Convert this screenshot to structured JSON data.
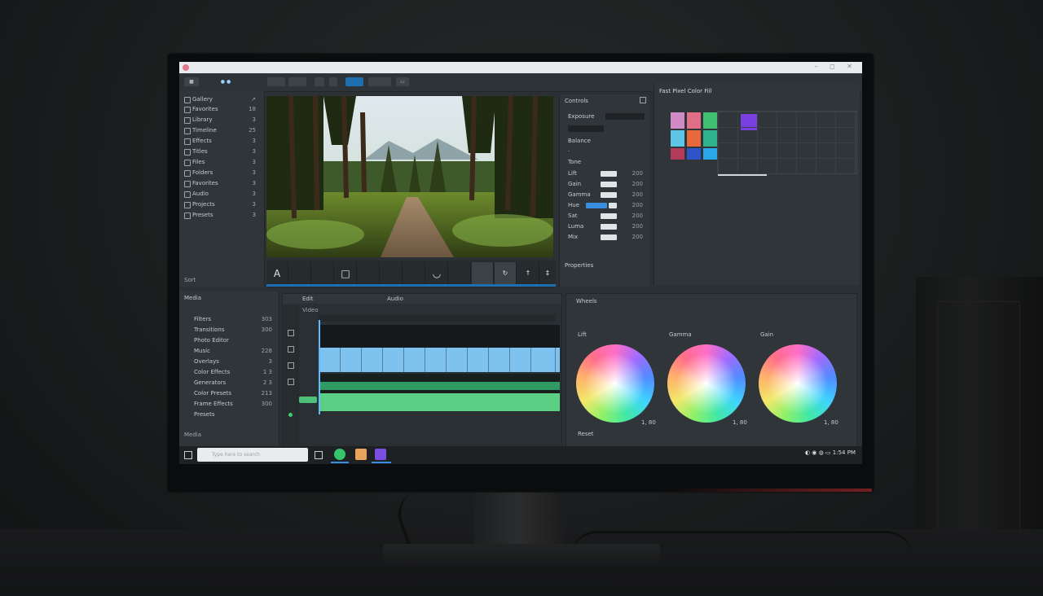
{
  "titlebar": {
    "title": "",
    "controls": "– ◻ ✕"
  },
  "toolbar": {
    "buttons": [
      "",
      "",
      "",
      "",
      "",
      ""
    ]
  },
  "sidebar": {
    "items": [
      {
        "label": "Gallery",
        "count": ""
      },
      {
        "label": "Favorites",
        "count": "18"
      },
      {
        "label": "Library",
        "count": "3"
      },
      {
        "label": "Timeline",
        "count": "25"
      },
      {
        "label": "Effects",
        "count": "3"
      },
      {
        "label": "Titles",
        "count": "3"
      },
      {
        "label": "Files",
        "count": "3"
      },
      {
        "label": "Folders",
        "count": "3"
      },
      {
        "label": "Favorites",
        "count": "3"
      },
      {
        "label": "Audio",
        "count": "3"
      },
      {
        "label": "Projects",
        "count": "3"
      },
      {
        "label": "Presets",
        "count": "3"
      }
    ],
    "footer": "Sort"
  },
  "viewer_tools": [
    "A",
    "□",
    "",
    "",
    "",
    "",
    "◡",
    "",
    "",
    "↻",
    "↑",
    "↕"
  ],
  "inspector": {
    "title": "Controls",
    "rows": [
      {
        "k": "Exposure",
        "v": ""
      },
      {
        "k": "",
        "v": ""
      },
      {
        "k": "Balance",
        "v": ""
      },
      {
        "k": "",
        "v": ""
      },
      {
        "k": "Tone",
        "v": ""
      },
      {
        "k": "Lift",
        "v": "200"
      },
      {
        "k": "Gain",
        "v": "200"
      },
      {
        "k": "Gamma",
        "v": "200"
      },
      {
        "k": "Hue",
        "v": "200"
      },
      {
        "k": "Sat",
        "v": "200"
      },
      {
        "k": "Luma",
        "v": "200"
      },
      {
        "k": "Mix",
        "v": "200"
      }
    ],
    "footer": "Properties"
  },
  "swatch_panel": {
    "tabs": [
      "Fast",
      "Pixel",
      "Color",
      "Fill"
    ]
  },
  "bottom_left": {
    "header": "Media",
    "items": [
      {
        "label": "Filters",
        "count": "303"
      },
      {
        "label": "Transitions",
        "count": "300"
      },
      {
        "label": "Photo Editor",
        "count": ""
      },
      {
        "label": "Music",
        "count": "228"
      },
      {
        "label": "Overlays",
        "count": "3"
      },
      {
        "label": "Color Effects",
        "count": "1 3"
      },
      {
        "label": "Generators",
        "count": "2 3"
      },
      {
        "label": "Color Presets",
        "count": "213"
      },
      {
        "label": "Frame Effects",
        "count": "300"
      },
      {
        "label": "Presets",
        "count": ""
      }
    ],
    "footer": "Media"
  },
  "timeline": {
    "tab1": "Edit",
    "tab2": "Audio",
    "ruler_label": "Video"
  },
  "wheels": {
    "title": "Wheels",
    "labels": [
      "Lift",
      "Gamma",
      "Gain"
    ],
    "values": [
      "1, 80",
      "1, 80",
      "1, 80"
    ],
    "footer": "Reset"
  },
  "taskbar": {
    "search_placeholder": "Type here to search",
    "clock": "1:54 PM"
  }
}
